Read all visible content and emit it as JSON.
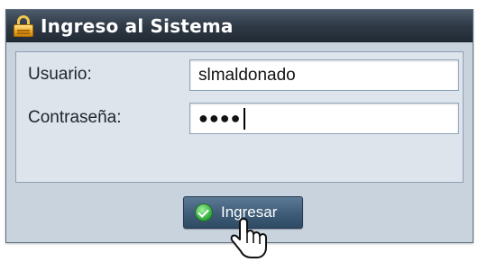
{
  "window": {
    "title": "Ingreso al Sistema",
    "icon": "lock-icon"
  },
  "form": {
    "username": {
      "label": "Usuario:",
      "value": "slmaldonado"
    },
    "password": {
      "label": "Contraseña:",
      "value": "●●●●"
    }
  },
  "actions": {
    "submit_label": "Ingresar",
    "submit_icon": "check-circle-icon"
  },
  "cursor": {
    "type": "hand-pointer-icon"
  },
  "colors": {
    "titlebar": "#2f3a47",
    "window_bg": "#c9d3de",
    "panel_bg": "#dde4ec",
    "button": "#3e5c78",
    "lock": "#e8a21a",
    "check": "#2ea53a"
  }
}
